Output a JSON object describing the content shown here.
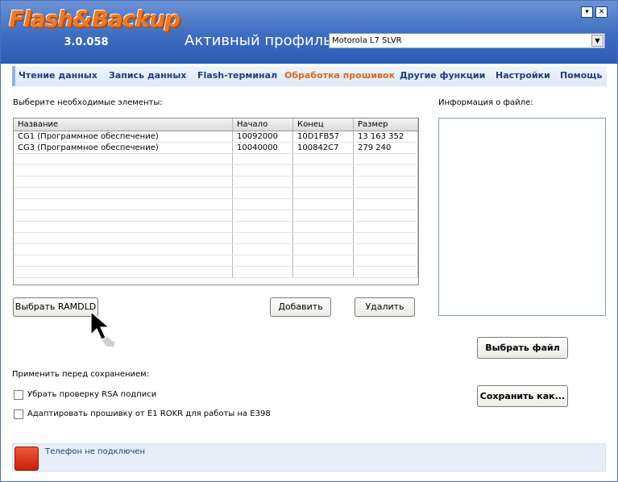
{
  "app": {
    "logo": "Flash&Backup",
    "version": "3.0.058"
  },
  "header": {
    "profile_label": "Активный профиль:",
    "profile_value": "Motorola L7 SLVR"
  },
  "nav": [
    {
      "label": "Чтение данных",
      "active": false
    },
    {
      "label": "Запись данных",
      "active": false
    },
    {
      "label": "Flash-терминал",
      "active": false
    },
    {
      "label": "Обработка прошивок",
      "active": true
    },
    {
      "label": "Другие функции",
      "active": false
    },
    {
      "label": "Настройки",
      "active": false
    },
    {
      "label": "Помощь",
      "active": false
    }
  ],
  "main": {
    "select_label": "Выберите необходимые элементы:",
    "file_info_label": "Информация о файле:",
    "table": {
      "columns": [
        "Название",
        "Начало",
        "Конец",
        "Размер"
      ],
      "rows": [
        [
          "CG1 (Программное обеспечение)",
          "10092000",
          "10D1FB57",
          "13 163 352"
        ],
        [
          "CG3 (Программное обеспечение)",
          "10040000",
          "100842C7",
          "279 240"
        ]
      ]
    },
    "buttons": {
      "select_ramdld": "Выбрать RAMDLD",
      "add": "Добавить",
      "delete": "Удалить",
      "select_file": "Выбрать файл",
      "save_as": "Сохранить как..."
    },
    "apply_label": "Применить перед сохранением:",
    "options": [
      {
        "label": "Убрать проверку RSA подписи",
        "checked": false
      },
      {
        "label": "Адаптировать прошивку от E1 ROKR для работы на E398",
        "checked": false
      }
    ]
  },
  "status": {
    "text": "Телефон не подключен",
    "color": "#d9301a"
  }
}
